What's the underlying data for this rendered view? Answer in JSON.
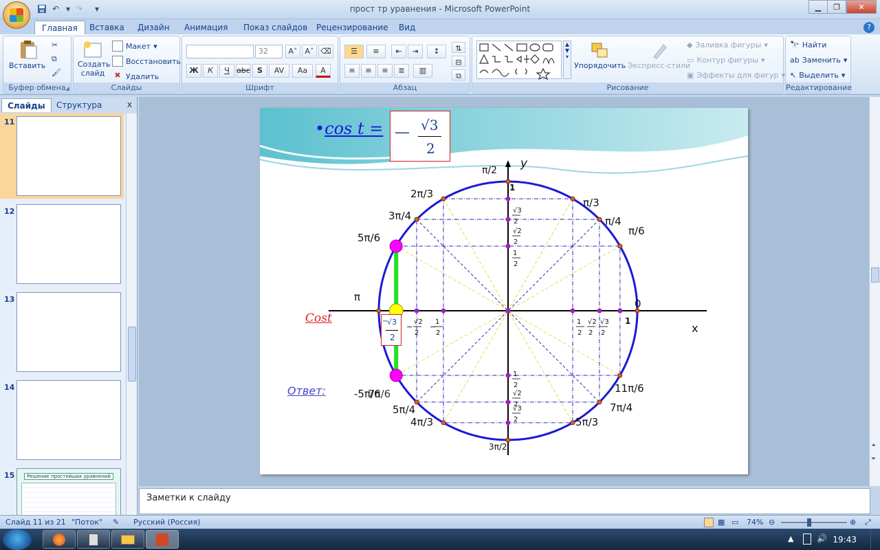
{
  "window": {
    "title": "прост тр уравнения - Microsoft PowerPoint"
  },
  "ribbon": {
    "tabs": [
      "Главная",
      "Вставка",
      "Дизайн",
      "Анимация",
      "Показ слайдов",
      "Рецензирование",
      "Вид"
    ],
    "active_tab": "Главная",
    "groups": {
      "clipboard": {
        "label": "Буфер обмена",
        "paste": "Вставить"
      },
      "slides": {
        "label": "Слайды",
        "new_slide": "Создать слайд",
        "layout": "Макет",
        "reset": "Восстановить",
        "delete": "Удалить"
      },
      "font": {
        "label": "Шрифт",
        "font_name": "",
        "font_size": "32"
      },
      "paragraph": {
        "label": "Абзац"
      },
      "drawing": {
        "label": "Рисование",
        "arrange": "Упорядочить",
        "quick_styles": "Экспресс-стили",
        "fill": "Заливка фигуры",
        "outline": "Контур фигуры",
        "effects": "Эффекты для фигур"
      },
      "editing": {
        "label": "Редактирование",
        "find": "Найти",
        "replace": "Заменить",
        "select": "Выделить"
      }
    }
  },
  "left_pane": {
    "tabs": [
      "Слайды",
      "Структура"
    ],
    "active_tab": "Слайды",
    "close": "x",
    "slide_numbers": [
      "11",
      "12",
      "13",
      "14",
      "15"
    ],
    "selected": "11",
    "thumb15_title": "Решение простейших уравнений"
  },
  "slide": {
    "formula": "cos t =",
    "minus": "—",
    "sqrt_num": "√3",
    "den": "2",
    "axis_y": "y",
    "axis_x": "x",
    "labels": {
      "pi_half": "π/2",
      "three_pi_half": "3π/2",
      "pi": "π",
      "zero": "0",
      "one_right": "1",
      "one_top": "1",
      "pi3": "π/3",
      "pi4": "π/4",
      "pi6": "π/6",
      "two_pi3": "2π/3",
      "three_pi4": "3π/4",
      "five_pi6": "5π/6",
      "eleven_pi6": "11π/6",
      "seven_pi4": "7π/4",
      "five_pi3": "5π/3",
      "four_pi3": "4π/3",
      "five_pi4": "5π/4",
      "seven_pi6": "-5π/6",
      "seven_pi6_b": "7π/6",
      "cost": "Cost",
      "answer": "Ответ:",
      "half": "1",
      "two": "2",
      "sqrt2": "√2",
      "sqrt3": "√3",
      "neg": "−"
    }
  },
  "notes": {
    "placeholder": "Заметки к слайду"
  },
  "statusbar": {
    "slide_info": "Слайд 11 из 21",
    "theme": "\"Поток\"",
    "language": "Русский (Россия)",
    "zoom": "74%"
  },
  "taskbar": {
    "clock": "19:43"
  },
  "colors": {
    "circle": "#1a1ad6",
    "answer_green": "#22e022",
    "magenta_point": "#ff00ff",
    "yellow_point": "#ffff00",
    "red_text": "#e02020"
  }
}
